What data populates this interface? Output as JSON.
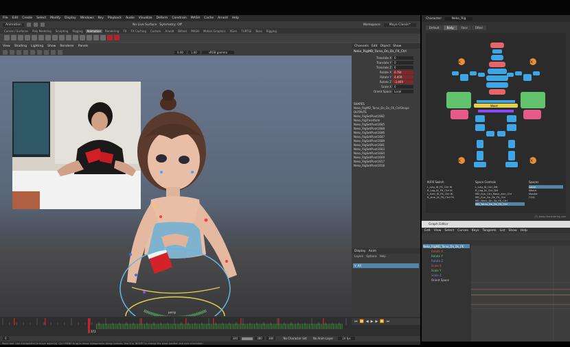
{
  "workspace": {
    "label": "Workspace:",
    "value": "Maya Classic*"
  },
  "maya": {
    "menus": [
      "File",
      "Edit",
      "Create",
      "Select",
      "Modify",
      "Display",
      "Windows",
      "Key",
      "Playback",
      "Audio",
      "Visualize",
      "Deform",
      "Constrain",
      "MASH",
      "Cache",
      "Arnold",
      "Help"
    ],
    "mode": "Animation",
    "no_live_surface": "No Live Surface",
    "symmetry": "Symmetry: Off",
    "shelf_tabs": [
      "Curves / Surfaces",
      "Poly Modeling",
      "Sculpting",
      "Rigging",
      "Animation",
      "Rendering",
      "FX",
      "FX Caching",
      "Custom",
      "Arnold",
      "Bifrost",
      "MASH",
      "Motion Graphics",
      "XGen",
      "TURTLE",
      "Boss",
      "Rigging"
    ],
    "active_shelf_tab": "Animation",
    "viewport_menus": [
      "View",
      "Shading",
      "Lighting",
      "Show",
      "Renderer",
      "Panels"
    ],
    "camera_field": "0.00",
    "camera_scale": "1.00",
    "color_space": "sRGB gamma",
    "camera_label": "persp"
  },
  "channel_box": {
    "menus": [
      "Channels",
      "Edit",
      "Object",
      "Show"
    ],
    "object": "Neko_RigMD_Torso_Dn_Ds_FK_Ctrl",
    "attributes": [
      {
        "name": "Translate X",
        "value": "0"
      },
      {
        "name": "Translate Y",
        "value": "0"
      },
      {
        "name": "Translate Z",
        "value": "0"
      },
      {
        "name": "Rotate X",
        "value": "0.76t"
      },
      {
        "name": "Rotate Y",
        "value": "4.459"
      },
      {
        "name": "Rotate Z",
        "value": "-3.469"
      },
      {
        "name": "Scale X",
        "value": "0"
      },
      {
        "name": "Orient Space",
        "value": "Local"
      }
    ],
    "shapes_label": "SHAPES",
    "shape_name": "Neko_RigMD_Torso_Dn_Ds_FK_CtrlShape",
    "outputs_label": "OUTPUTS",
    "outputs": [
      "Neko_RigSetPivot1682",
      "Neko_RigTransform",
      "Neko_RigSetPivot1685",
      "Neko_RigSetPivot1688",
      "Neko_RigSetPivot1686",
      "Neko_RigSetPivot1687",
      "Neko_RigSetPivot1689",
      "Neko_RigSetPivot1681",
      "Neko_RigSetPivot1683",
      "Neko_RigSetPivot1684",
      "Neko_RigSetPivot1669",
      "Neko_RigSetPivot1657",
      "Neko_RigSetPivot1658"
    ]
  },
  "layers": {
    "tabs": [
      "Display",
      "Anim"
    ],
    "menus": [
      "Layers",
      "Options",
      "Help"
    ],
    "layer_name": "V",
    "layer_label": "All"
  },
  "timeline": {
    "current_frame": "372",
    "start": "0",
    "range_start": "340",
    "range_end": "380",
    "end": "380",
    "character_set": "No Character Set",
    "anim_layer": "No Anim Layer",
    "fps": "24 fps"
  },
  "help_line": "Move tool: Use manipulator to move object(s). Ctrl+MMB+drag to move components along normals. Use D or INSERT to change the pivot position and axis orientation.",
  "picker": {
    "character_label": "Character:",
    "character_value": "Neko_Rig",
    "tabs": [
      "Default",
      "Body",
      "Face",
      "Other"
    ],
    "active_tab": "Body",
    "labels": {
      "ik_l": "IK",
      "fk_r": "FK",
      "ik_r_low": "IK",
      "fk_l_low": "FK",
      "waist": "Waist",
      "ik_br": "IK",
      "fk_bl": "FK"
    },
    "footer_hint": "Alt+LMB Click to Select the widget for multiple selection",
    "lists": {
      "fkik_header": "IK/FK Switch",
      "fkik_items": [
        "L_Leg_IK_FK_Ctrl  IK",
        "R_Leg_IK_FK_Ctrl  IK",
        "L_Arm_IK_FK_Ctrl  IK",
        "R_Arm_IK_FK_Ctrl  FK"
      ],
      "space_header": "Space Controls",
      "space_items": [
        "L_Leg_IK_Ctrl_Dft",
        "R_Leg_IK_Ctrl_Dft",
        "MD_Eye_Ctrl_Mask_Aim_Ctrl",
        "MD_Eye_Dn_Ds_FK_Ctrl",
        "MD_Neck_Dn_Ds_FK_Ctrl",
        "MD_Torso_Dn_Ds_FK_Ctrl"
      ],
      "space_selected": 5,
      "spaces_header": "Spaces",
      "spaces_items": [
        "Local",
        "World",
        "Master",
        "COG"
      ],
      "spaces_selected": 0
    },
    "copyright": "(C) www.characterrig.com"
  },
  "graph_editor": {
    "title": "Graph Editor",
    "menus": [
      "Edit",
      "View",
      "Select",
      "Curves",
      "Keys",
      "Tangents",
      "List",
      "Show",
      "Help"
    ],
    "outliner": [
      {
        "label": "Neko_RigMD_Torso_Dn_Ds_FK",
        "selected": true
      },
      {
        "label": "Rotate X",
        "selected": false,
        "color": "#e05a4f"
      },
      {
        "label": "Rotate Y",
        "selected": false,
        "color": "#6fd06a"
      },
      {
        "label": "Rotate Z",
        "selected": false,
        "color": "#6e8ce0"
      },
      {
        "label": "Scale X",
        "selected": false,
        "color": "#e05a4f"
      },
      {
        "label": "Scale Y",
        "selected": false,
        "color": "#6fd06a"
      },
      {
        "label": "Scale Z",
        "selected": false,
        "color": "#6e8ce0"
      },
      {
        "label": "Orient Space",
        "selected": false,
        "color": "#cfcfcf"
      }
    ]
  }
}
